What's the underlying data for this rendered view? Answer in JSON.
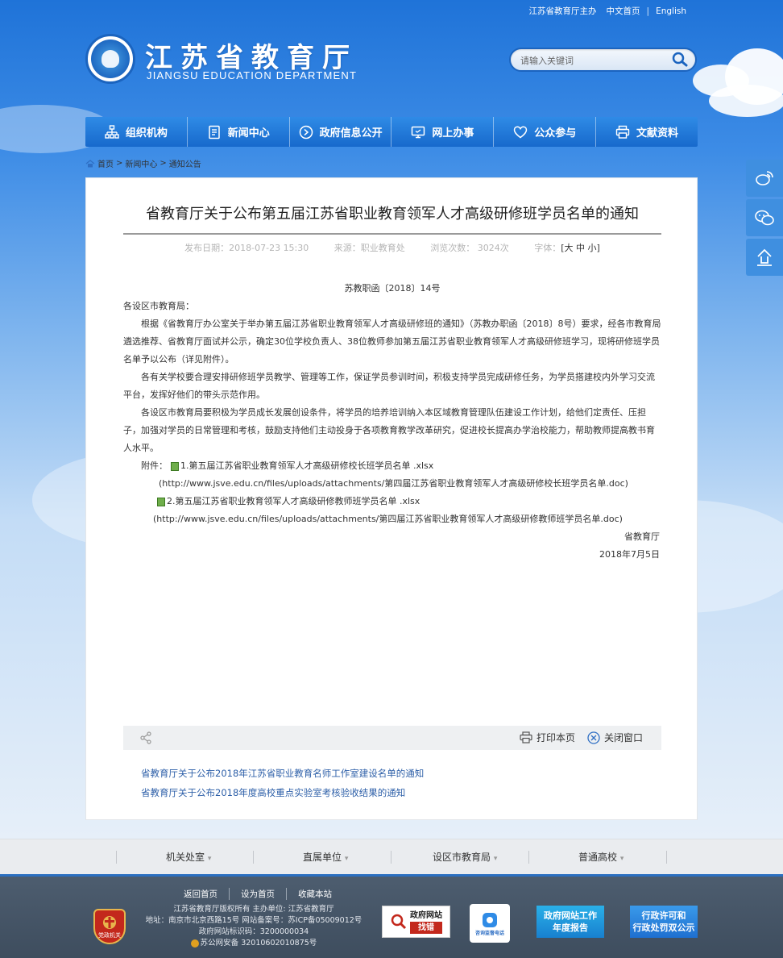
{
  "top_links": {
    "sponsor": "江苏省教育厅主办",
    "chinese": "中文首页",
    "english": "English"
  },
  "header": {
    "title": "江苏省教育厅",
    "subtitle": "JIANGSU EDUCATION DEPARTMENT",
    "search_placeholder": "请输入关键词"
  },
  "nav": [
    {
      "label": "组织机构",
      "icon": "org-chart-icon"
    },
    {
      "label": "新闻中心",
      "icon": "document-icon"
    },
    {
      "label": "政府信息公开",
      "icon": "info-icon"
    },
    {
      "label": "网上办事",
      "icon": "monitor-icon"
    },
    {
      "label": "公众参与",
      "icon": "heart-icon"
    },
    {
      "label": "文献资料",
      "icon": "printer-icon"
    }
  ],
  "breadcrumb": [
    "首页",
    "新闻中心",
    "通知公告"
  ],
  "article": {
    "title": "省教育厅关于公布第五届江苏省职业教育领军人才高级研修班学员名单的通知",
    "publish_label": "发布日期：2018-07-23 15:30",
    "source_label": "来源：职业教育处",
    "views_label": "浏览次数：",
    "views": "3024次",
    "font_label": "字体：",
    "font_sizes": "[大 中 小]",
    "doc_number": "苏教职函〔2018〕14号",
    "salutation": "各设区市教育局：",
    "para1": "根据《省教育厅办公室关于举办第五届江苏省职业教育领军人才高级研修班的通知》（苏教办职函〔2018〕8号）要求，经各市教育局遴选推荐、省教育厅面试并公示，确定30位学校负责人、38位教师参加第五届江苏省职业教育领军人才高级研修班学习，现将研修班学员名单予以公布（详见附件）。",
    "para2": "各有关学校要合理安排研修班学员教学、管理等工作，保证学员参训时间，积极支持学员完成研修任务，为学员搭建校内外学习交流平台，发挥好他们的带头示范作用。",
    "para3": "各设区市教育局要积极为学员成长发展创设条件，将学员的培养培训纳入本区域教育管理队伍建设工作计划，给他们定责任、压担子，加强对学员的日常管理和考核，鼓励支持他们主动投身于各项教育教学改革研究，促进校长提高办学治校能力，帮助教师提高教书育人水平。",
    "attachments_label": "附件：",
    "attachment1": "1.第五届江苏省职业教育领军人才高级研修校长班学员名单 .xlsx",
    "attachment1_url": "(http://www.jsve.edu.cn/files/uploads/attachments/第四届江苏省职业教育领军人才高级研修校长班学员名单.doc)",
    "attachment2": "2.第五届江苏省职业教育领军人才高级研修教师班学员名单 .xlsx",
    "attachment2_url": "(http://www.jsve.edu.cn/files/uploads/attachments/第四届江苏省职业教育领军人才高级研修教师班学员名单.doc)",
    "signature": "省教育厅",
    "date": "2018年7月5日"
  },
  "toolbar": {
    "print": "打印本页",
    "close": "关闭窗口"
  },
  "related": [
    "省教育厅关于公布2018年江苏省职业教育名师工作室建设名单的通知",
    "省教育厅关于公布2018年度高校重点实验室考核验收结果的通知"
  ],
  "links_bar": [
    "机关处室",
    "直属单位",
    "设区市教育局",
    "普通高校"
  ],
  "footer": {
    "links": [
      "返回首页",
      "设为首页",
      "收藏本站"
    ],
    "line1": "江苏省教育厅版权所有 主办单位: 江苏省教育厅",
    "line2": "地址：南京市北京西路15号 网站备案号：苏ICP备05009012号",
    "line3": "政府网站标识码：3200000034",
    "line4": "苏公网安备 32010602010875号",
    "badge_text": "党政机关",
    "btn_error_1": "政府网站",
    "btn_error_2": "找错",
    "btn_phone": "咨询监督电话",
    "btn_report_1": "政府网站工作",
    "btn_report_2": "年度报告",
    "btn_permit_1": "行政许可和",
    "btn_permit_2": "行政处罚双公示"
  }
}
